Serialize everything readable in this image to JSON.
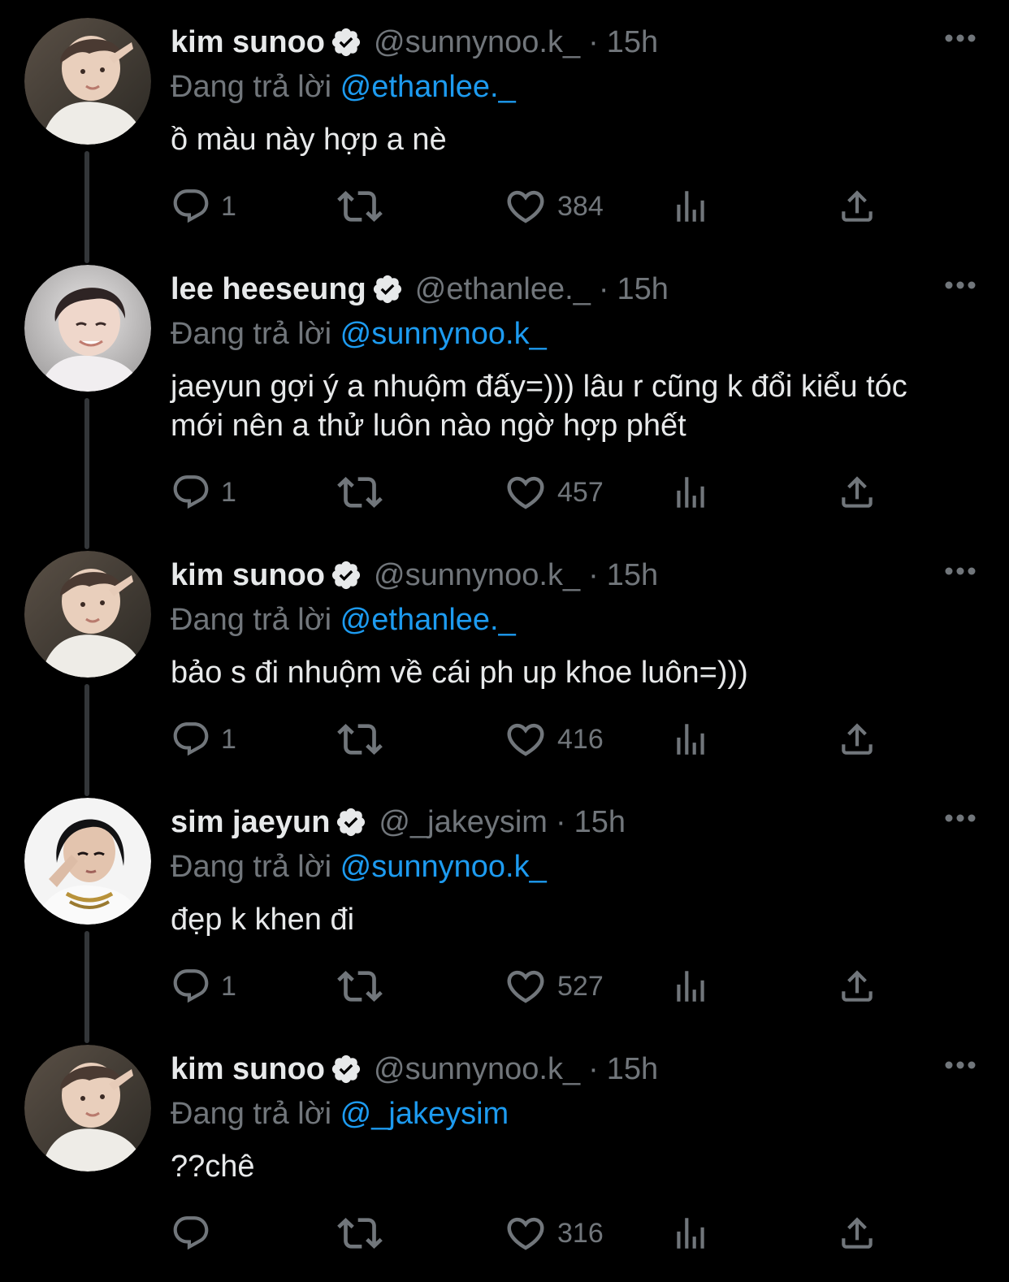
{
  "thread": [
    {
      "name": "kim sunoo",
      "handle": "@sunnynoo.k_",
      "time": "15h",
      "reply_prefix": "Đang trả lời",
      "reply_to": "@ethanlee._",
      "text": "ồ màu này hợp a nè",
      "replies": "1",
      "retweets": "",
      "likes": "384",
      "avatar": "sunoo"
    },
    {
      "name": "lee heeseung",
      "handle": "@ethanlee._",
      "time": "15h",
      "reply_prefix": "Đang trả lời",
      "reply_to": "@sunnynoo.k_",
      "text": "jaeyun gợi ý a nhuộm đấy=))) lâu r cũng k đổi kiểu tóc mới nên a thử luôn nào ngờ hợp phết",
      "replies": "1",
      "retweets": "",
      "likes": "457",
      "avatar": "heeseung"
    },
    {
      "name": "kim sunoo",
      "handle": "@sunnynoo.k_",
      "time": "15h",
      "reply_prefix": "Đang trả lời",
      "reply_to": "@ethanlee._",
      "text": "bảo s đi nhuộm về cái ph up khoe luôn=)))",
      "replies": "1",
      "retweets": "",
      "likes": "416",
      "avatar": "sunoo"
    },
    {
      "name": "sim jaeyun",
      "handle": "@_jakeysim",
      "time": "15h",
      "reply_prefix": "Đang trả lời",
      "reply_to": "@sunnynoo.k_",
      "text": "đẹp k khen đi",
      "replies": "1",
      "retweets": "",
      "likes": "527",
      "avatar": "jaeyun"
    },
    {
      "name": "kim sunoo",
      "handle": "@sunnynoo.k_",
      "time": "15h",
      "reply_prefix": "Đang trả lời",
      "reply_to": "@_jakeysim",
      "text": "??chê",
      "replies": "",
      "retweets": "",
      "likes": "316",
      "avatar": "sunoo"
    }
  ],
  "separator": "·",
  "colors": {
    "background": "#000000",
    "text": "#e7e9ea",
    "muted": "#71767b",
    "link": "#1d9bf0",
    "thread_line": "#333639"
  },
  "icons": [
    "reply-icon",
    "retweet-icon",
    "like-icon",
    "views-icon",
    "share-icon",
    "verified-icon",
    "more-icon"
  ]
}
